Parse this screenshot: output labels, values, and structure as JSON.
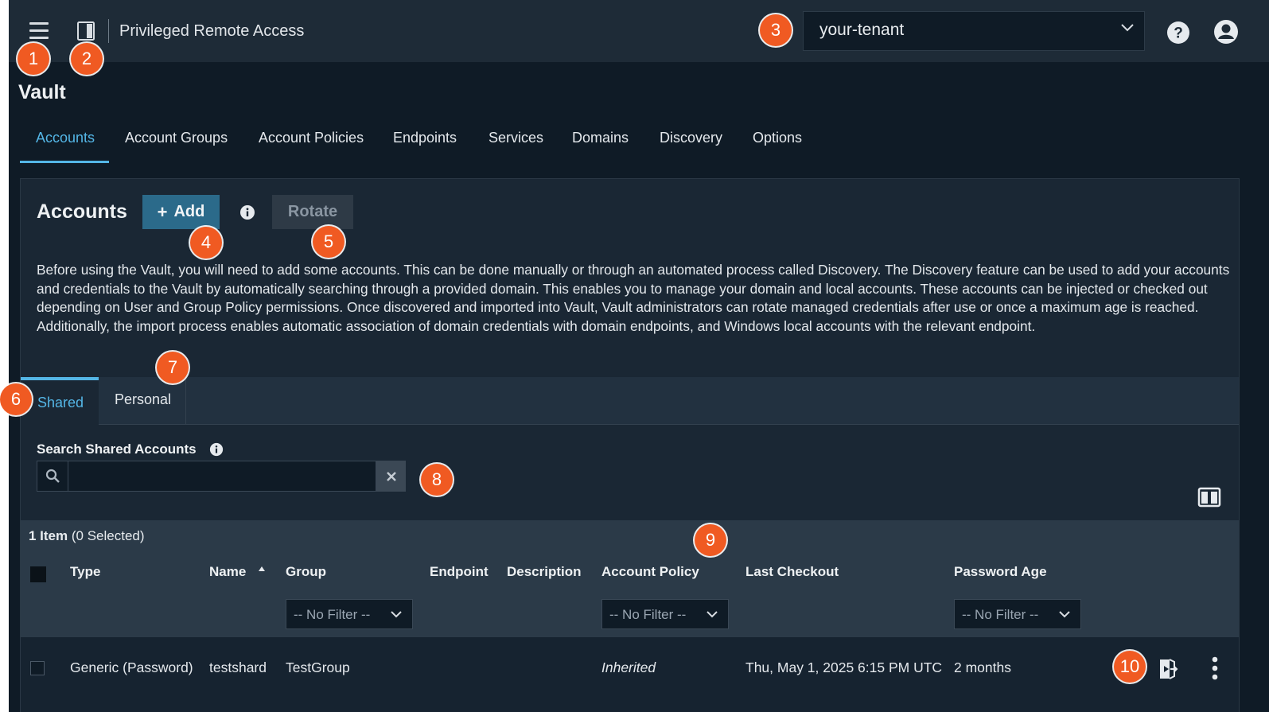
{
  "topbar": {
    "app_title": "Privileged Remote Access",
    "tenant": "your-tenant"
  },
  "page": {
    "title": "Vault"
  },
  "nav": {
    "tabs": [
      {
        "label": "Accounts",
        "active": true
      },
      {
        "label": "Account Groups"
      },
      {
        "label": "Account Policies"
      },
      {
        "label": "Endpoints"
      },
      {
        "label": "Services"
      },
      {
        "label": "Domains"
      },
      {
        "label": "Discovery"
      },
      {
        "label": "Options"
      }
    ]
  },
  "accounts": {
    "title": "Accounts",
    "add_label": "Add",
    "rotate_label": "Rotate",
    "description": "Before using the Vault, you will need to add some accounts. This can be done manually or through an automated process called Discovery. The Discovery feature can be used to add your accounts and credentials to the Vault by automatically searching through a provided domain. This enables you to manage your domain and local accounts. These accounts can be injected or checked out depending on User and Group Policy permissions. Once discovered and imported into Vault, Vault administrators can rotate managed credentials after use or once a maximum age is reached. Additionally, the import process enables automatic association of domain credentials with domain endpoints, and Windows local accounts with the relevant endpoint."
  },
  "subtabs": {
    "shared": "Shared",
    "personal": "Personal"
  },
  "search": {
    "label": "Search Shared Accounts",
    "value": ""
  },
  "table": {
    "count_bold": "1 Item",
    "count_rest": " (0 Selected)",
    "columns": [
      "Type",
      "Name",
      "Group",
      "Endpoint",
      "Description",
      "Account Policy",
      "Last Checkout",
      "Password Age"
    ],
    "filter_placeholder": "-- No Filter --",
    "rows": [
      {
        "type": "Generic (Password)",
        "name": "testshard",
        "group": "TestGroup",
        "endpoint": "",
        "description": "",
        "account_policy": "Inherited",
        "last_checkout": "Thu, May 1, 2025 6:15 PM UTC",
        "password_age": "2 months"
      }
    ]
  },
  "badges": [
    "1",
    "2",
    "3",
    "4",
    "5",
    "6",
    "7",
    "8",
    "9",
    "10"
  ],
  "colors": {
    "accent": "#54b6e6",
    "badge": "#f05a22",
    "primary_button": "#2b6a8a"
  }
}
